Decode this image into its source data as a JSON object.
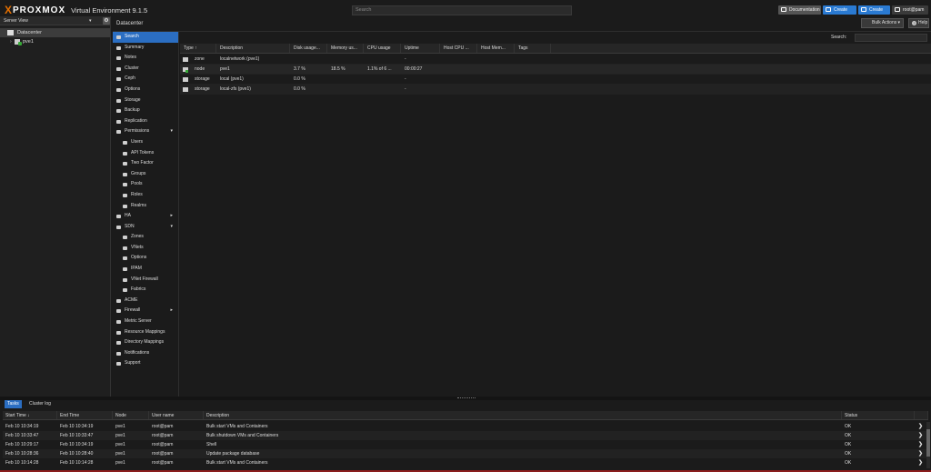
{
  "topbar": {
    "brand_x": "X",
    "brand_name": "PROXMOX",
    "version": "Virtual Environment 9.1.5",
    "search_placeholder": "Search",
    "documentation": "Documentation",
    "create_vm": "Create VM",
    "create_ct": "Create CT",
    "user": "root@pam",
    "user_chevron": "▾"
  },
  "server_view": {
    "title": "Server View",
    "chevron": "▾",
    "gear": "⚙",
    "tree": [
      {
        "label": "Datacenter"
      },
      {
        "label": "pve1",
        "twist": "›"
      }
    ]
  },
  "content_header": {
    "title": "Datacenter",
    "bulk_actions": "Bulk Actions",
    "bulk_chevron": "▾",
    "help": "Help",
    "help_icon": "?"
  },
  "nav": [
    {
      "label": "Search",
      "active": true
    },
    {
      "label": "Summary"
    },
    {
      "label": "Notes"
    },
    {
      "label": "Cluster"
    },
    {
      "label": "Ceph"
    },
    {
      "label": "Options"
    },
    {
      "label": "Storage"
    },
    {
      "label": "Backup"
    },
    {
      "label": "Replication"
    },
    {
      "label": "Permissions",
      "arrow": "▾"
    },
    {
      "label": "Users",
      "sub": true
    },
    {
      "label": "API Tokens",
      "sub": true
    },
    {
      "label": "Two Factor",
      "sub": true
    },
    {
      "label": "Groups",
      "sub": true
    },
    {
      "label": "Pools",
      "sub": true
    },
    {
      "label": "Roles",
      "sub": true
    },
    {
      "label": "Realms",
      "sub": true
    },
    {
      "label": "HA",
      "arrow": "▸"
    },
    {
      "label": "SDN",
      "arrow": "▾"
    },
    {
      "label": "Zones",
      "sub": true
    },
    {
      "label": "VNets",
      "sub": true
    },
    {
      "label": "Options",
      "sub": true
    },
    {
      "label": "IPAM",
      "sub": true
    },
    {
      "label": "VNet Firewall",
      "sub": true
    },
    {
      "label": "Fabrics",
      "sub": true
    },
    {
      "label": "ACME"
    },
    {
      "label": "Firewall",
      "arrow": "▸"
    },
    {
      "label": "Metric Server"
    },
    {
      "label": "Resource Mappings"
    },
    {
      "label": "Directory Mappings"
    },
    {
      "label": "Notifications"
    },
    {
      "label": "Support"
    }
  ],
  "resource_grid": {
    "search_label": "Search:",
    "columns": [
      "Type ↑",
      "Description",
      "Disk usage...",
      "Memory us...",
      "CPU usage",
      "Uptime",
      "Host CPU ...",
      "Host Mem...",
      "Tags"
    ],
    "rows": [
      {
        "type": "zone",
        "description": "localnetwork (pve1)",
        "disk": "",
        "memory": "",
        "cpu": "",
        "uptime": "-",
        "host_cpu": "",
        "host_mem": "",
        "tags": ""
      },
      {
        "type": "node",
        "description": "pve1",
        "disk": "3.7 %",
        "memory": "18.5 %",
        "cpu": "1.1% of 6 ...",
        "uptime": "00:00:27",
        "host_cpu": "",
        "host_mem": "",
        "tags": ""
      },
      {
        "type": "storage",
        "description": "local (pve1)",
        "disk": "0.0 %",
        "memory": "",
        "cpu": "",
        "uptime": "-",
        "host_cpu": "",
        "host_mem": "",
        "tags": ""
      },
      {
        "type": "storage",
        "description": "local-zfs (pve1)",
        "disk": "0.0 %",
        "memory": "",
        "cpu": "",
        "uptime": "-",
        "host_cpu": "",
        "host_mem": "",
        "tags": ""
      }
    ]
  },
  "tasks": {
    "tabs": [
      "Tasks",
      "Cluster log"
    ],
    "columns": [
      "Start Time ↓",
      "End Time",
      "Node",
      "User name",
      "Description",
      "Status"
    ],
    "rows": [
      {
        "start": "Feb 10 10:34:19",
        "end": "Feb 10 10:34:19",
        "node": "pve1",
        "user": "root@pam",
        "description": "Bulk start VMs and Containers",
        "status": "OK"
      },
      {
        "start": "Feb 10 10:33:47",
        "end": "Feb 10 10:33:47",
        "node": "pve1",
        "user": "root@pam",
        "description": "Bulk shutdown VMs and Containers",
        "status": "OK"
      },
      {
        "start": "Feb 10 10:29:17",
        "end": "Feb 10 10:34:19",
        "node": "pve1",
        "user": "root@pam",
        "description": "Shell",
        "status": "OK"
      },
      {
        "start": "Feb 10 10:28:36",
        "end": "Feb 10 10:28:40",
        "node": "pve1",
        "user": "root@pam",
        "description": "Update package database",
        "status": "OK"
      },
      {
        "start": "Feb 10 10:14:28",
        "end": "Feb 10 10:14:28",
        "node": "pve1",
        "user": "root@pam",
        "description": "Bulk start VMs and Containers",
        "status": "OK"
      }
    ],
    "go_glyph": "❯"
  },
  "colors": {
    "accent": "#2b6ec2",
    "brand_orange": "#e57000",
    "background": "#1b1b1b",
    "status_running": "#37a837"
  }
}
